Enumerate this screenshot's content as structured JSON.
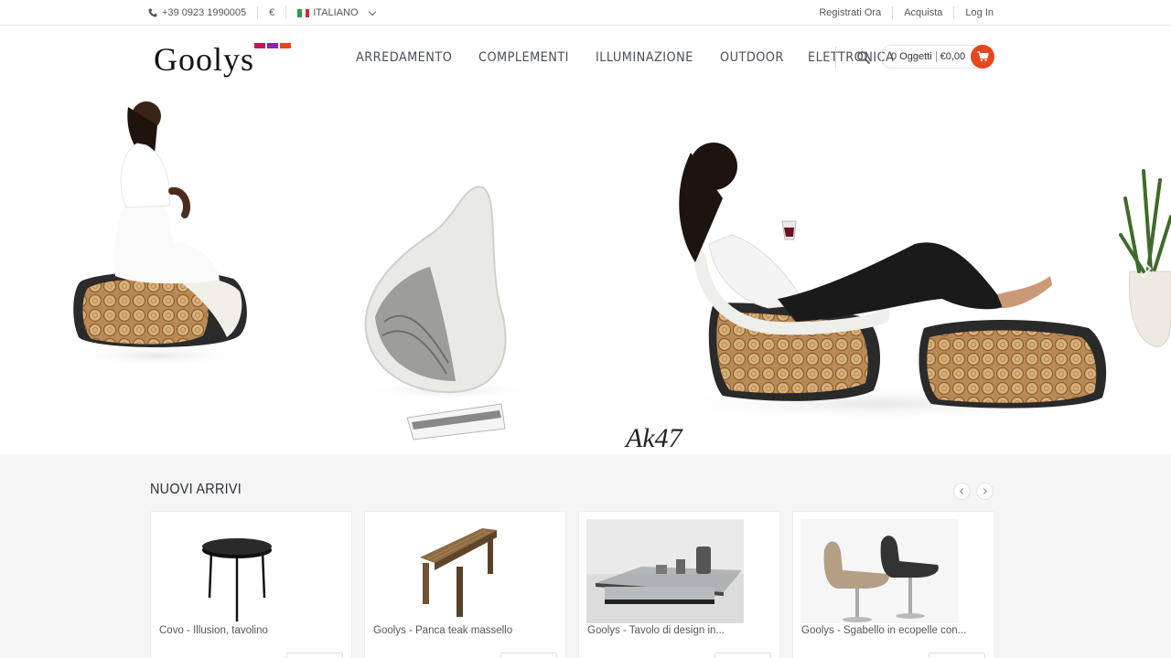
{
  "topbar": {
    "phone": "+39 0923 1990005",
    "currency": "€",
    "language": "ITALIANO",
    "links": [
      "Registrati Ora",
      "Acquista",
      "Log In"
    ]
  },
  "header": {
    "logo_text": "Goolys",
    "nav": [
      "ARREDAMENTO",
      "COMPLEMENTI",
      "ILLUMINAZIONE",
      "OUTDOOR",
      "ELETTRONICA"
    ],
    "cart_items": "0 Oggetti",
    "cart_total": "€0,00"
  },
  "hero": {
    "signature": "Ak47"
  },
  "arrivals": {
    "title": "NUOVI ARRIVI",
    "products": [
      {
        "name": "Covo - Illusion, tavolino",
        "price": ""
      },
      {
        "name": "Goolys - Panca teak massello",
        "price": ""
      },
      {
        "name": "Goolys - Tavolo di design in...",
        "price": ""
      },
      {
        "name": "Goolys - Sgabello in ecopelle con...",
        "price": ""
      }
    ]
  },
  "colors": {
    "accent": "#e8461e",
    "nav_text": "#4a4f57",
    "logo_squares": [
      "#c2185b",
      "#8e24aa",
      "#e8461e"
    ],
    "arrivals_bg": "#f5f5f5"
  },
  "icons": [
    "phone-icon",
    "flag-italy-icon",
    "chevron-down-icon",
    "search-icon",
    "cart-icon",
    "chevron-left-icon",
    "chevron-right-icon"
  ]
}
